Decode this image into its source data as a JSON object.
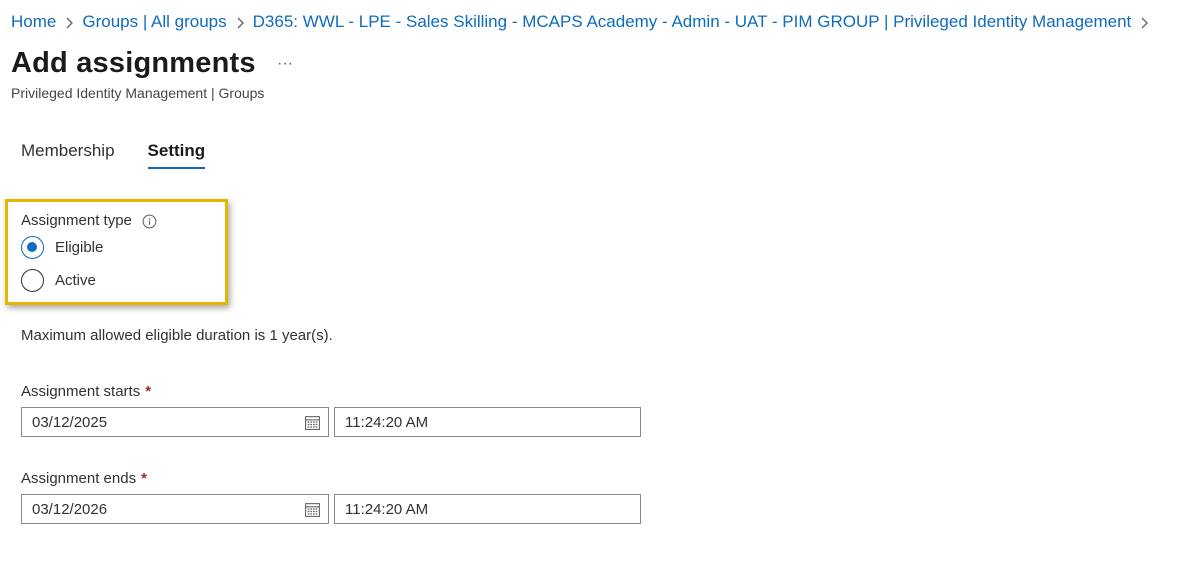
{
  "breadcrumb": {
    "items": [
      "Home",
      "Groups | All groups",
      "D365: WWL - LPE - Sales Skilling - MCAPS Academy - Admin - UAT - PIM GROUP | Privileged Identity Management"
    ]
  },
  "header": {
    "title": "Add assignments",
    "more_label": "···",
    "subtitle": "Privileged Identity Management | Groups"
  },
  "tabs": [
    {
      "label": "Membership",
      "active": false
    },
    {
      "label": "Setting",
      "active": true
    }
  ],
  "assignment_type": {
    "label": "Assignment type",
    "options": [
      {
        "label": "Eligible",
        "checked": true
      },
      {
        "label": "Active",
        "checked": false
      }
    ]
  },
  "note": "Maximum allowed eligible duration is 1 year(s).",
  "assignment_starts": {
    "label": "Assignment starts",
    "required_mark": "*",
    "date": "03/12/2025",
    "time": "11:24:20 AM"
  },
  "assignment_ends": {
    "label": "Assignment ends",
    "required_mark": "*",
    "date": "03/12/2026",
    "time": "11:24:20 AM"
  },
  "colors": {
    "link": "#0f6cbd",
    "highlight": "#e3b600",
    "required": "#a4262c"
  },
  "icons": [
    "chevron-right-icon",
    "more-icon",
    "info-icon",
    "calendar-icon"
  ]
}
